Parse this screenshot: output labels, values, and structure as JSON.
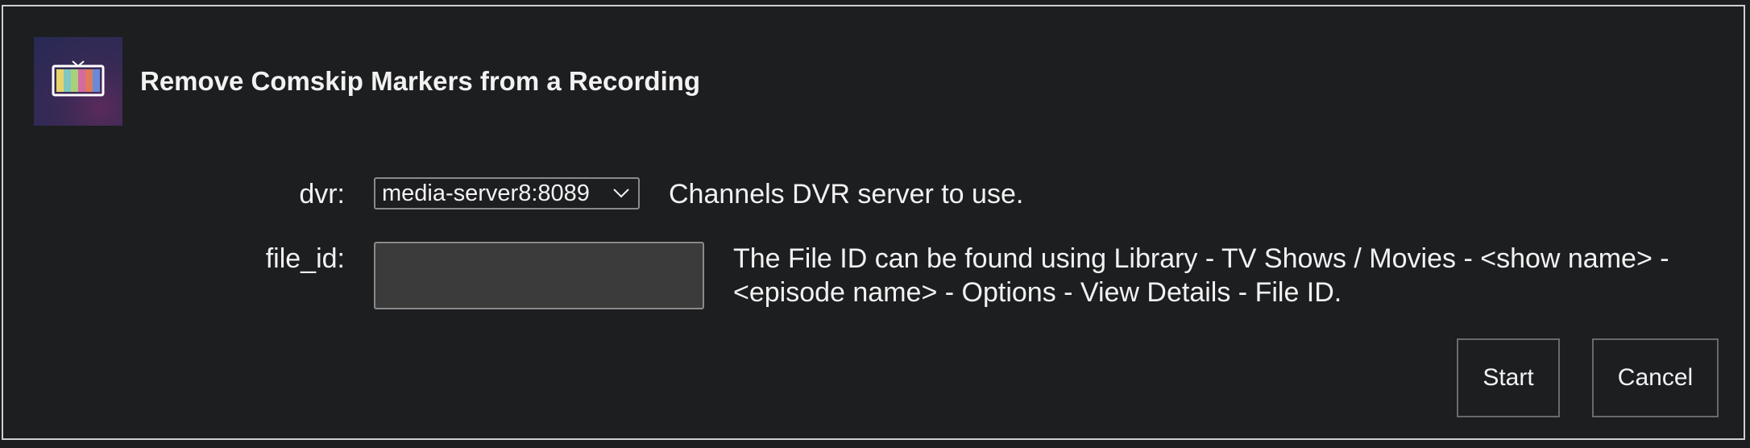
{
  "dialog": {
    "title": "Remove Comskip Markers from a Recording",
    "icon": "tv-icon"
  },
  "form": {
    "dvr": {
      "label": "dvr:",
      "selected": "media-server8:8089",
      "help": "Channels DVR server to use."
    },
    "file_id": {
      "label": "file_id:",
      "value": "",
      "help": "The File ID can be found using Library - TV Shows / Movies - <show name> - <episode name> - Options - View Details - File ID."
    }
  },
  "buttons": {
    "start": "Start",
    "cancel": "Cancel"
  },
  "colors": {
    "background": "#1d1e20",
    "border": "#cfcfcf",
    "input_bg": "#3b3b3b",
    "text": "#f2f2f2"
  }
}
